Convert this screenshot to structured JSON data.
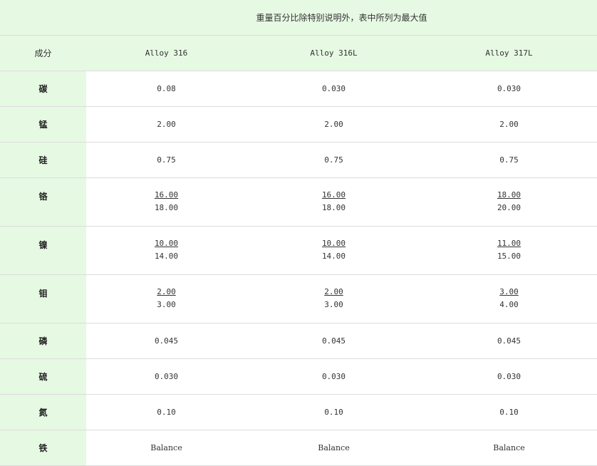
{
  "note": "重量百分比除特别说明外，表中所列为最大值",
  "header": {
    "label": "成分",
    "alloys": [
      "Alloy 316",
      "Alloy 316L",
      "Alloy 317L"
    ]
  },
  "rows": [
    {
      "element": "碳",
      "values": [
        "0.08",
        "0.030",
        "0.030"
      ]
    },
    {
      "element": "锰",
      "values": [
        "2.00",
        "2.00",
        "2.00"
      ]
    },
    {
      "element": "硅",
      "values": [
        "0.75",
        "0.75",
        "0.75"
      ]
    },
    {
      "element": "铬",
      "ranges": [
        [
          "16.00",
          "18.00"
        ],
        [
          "16.00",
          "18.00"
        ],
        [
          "18.00",
          "20.00"
        ]
      ]
    },
    {
      "element": "镍",
      "ranges": [
        [
          "10.00",
          "14.00"
        ],
        [
          "10.00",
          "14.00"
        ],
        [
          "11.00",
          "15.00"
        ]
      ]
    },
    {
      "element": "钼",
      "ranges": [
        [
          "2.00",
          "3.00"
        ],
        [
          "2.00",
          "3.00"
        ],
        [
          "3.00",
          "4.00"
        ]
      ]
    },
    {
      "element": "磷",
      "values": [
        "0.045",
        "0.045",
        "0.045"
      ]
    },
    {
      "element": "硫",
      "values": [
        "0.030",
        "0.030",
        "0.030"
      ]
    },
    {
      "element": "氮",
      "values": [
        "0.10",
        "0.10",
        "0.10"
      ]
    },
    {
      "element": "铁",
      "values": [
        "Balance",
        "Balance",
        "Balance"
      ]
    }
  ],
  "colors": {
    "header_bg": "#e6f9e3",
    "border": "#dcdcdc"
  }
}
